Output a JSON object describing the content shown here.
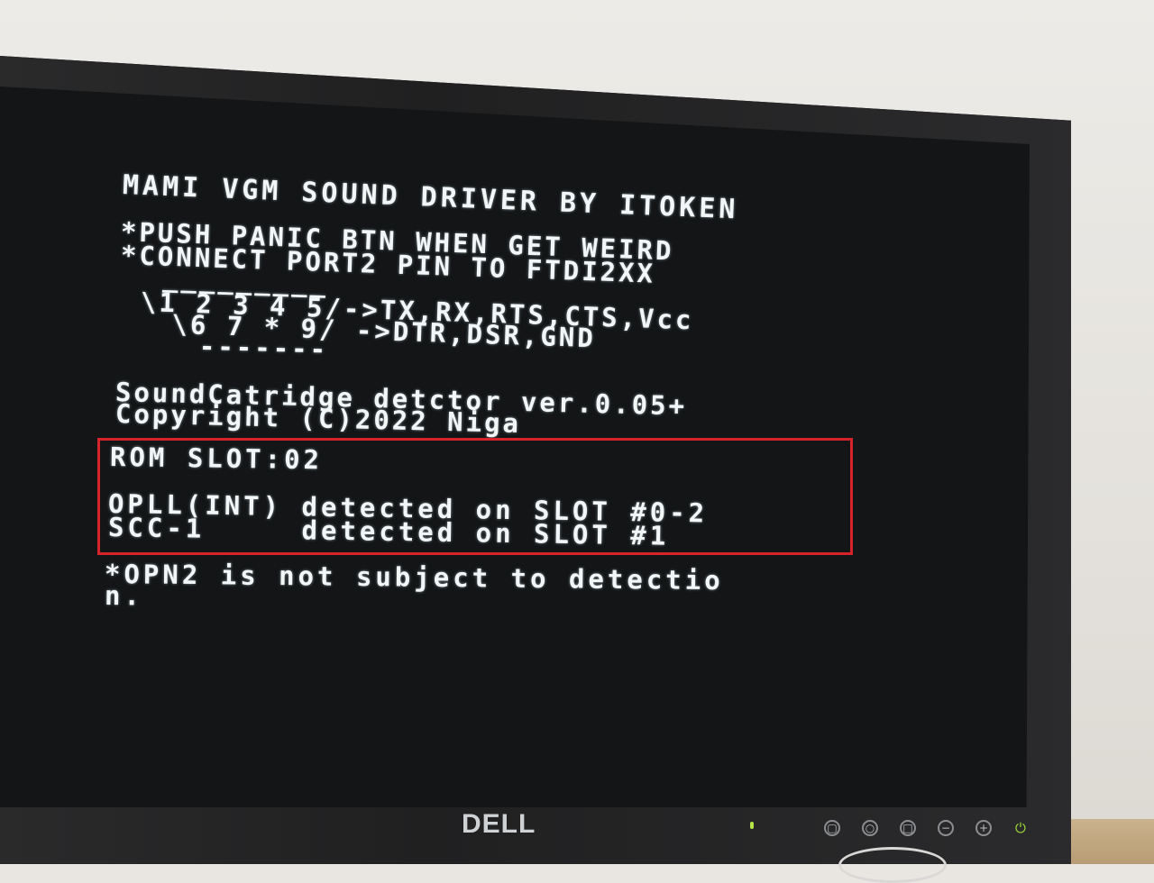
{
  "screen_text": {
    "title": "MAMI VGM SOUND DRIVER BY ITOKEN",
    "line_push": "*PUSH PANIC BTN WHEN GET WEIRD",
    "line_connect": "*CONNECT PORT2 PIN TO FTDI2XX",
    "pin_top_rule": " _________",
    "pin_row1": "\\1 2 3 4 5/->TX,RX,RTS,CTS,Vcc",
    "pin_row2": " \\6 7 * 9/ ->DTR,DSR,GND",
    "pin_bottom_rule": "  -------",
    "detector_title": "SoundCatridge detctor ver.0.05+",
    "copyright": "Copyright (C)2022 Niga",
    "rom_slot": "ROM SLOT:02",
    "opll_line": "OPLL(INT) detected on SLOT #0-2",
    "scc_line": "SCC-1     detected on SLOT #1",
    "opn2_note_1": "*OPN2 is not subject to detectio",
    "opn2_note_2": "n."
  },
  "monitor": {
    "brand": "DELL",
    "buttons": [
      "input-icon",
      "menu-icon",
      "auto-adjust-icon",
      "minus-icon",
      "plus-icon"
    ],
    "power_icon": "power-icon"
  },
  "colors": {
    "screen_bg": "#131516",
    "text": "#f2f6f7",
    "highlight": "#d8232a",
    "power_led": "#9fdc3a"
  }
}
